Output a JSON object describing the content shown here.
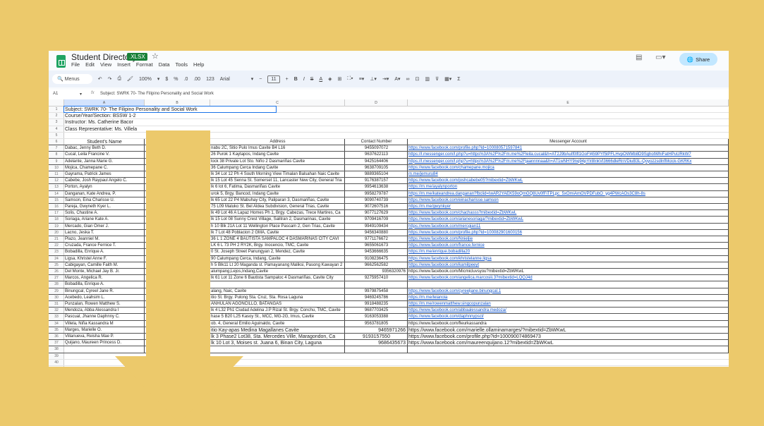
{
  "app": {
    "title": "Student Directory",
    "badge": ".XLSX",
    "menu": [
      "File",
      "Edit",
      "View",
      "Insert",
      "Format",
      "Data",
      "Tools",
      "Help"
    ],
    "share": "Share"
  },
  "toolbar": {
    "search": "Menus",
    "zoom": "100%",
    "currency": "$",
    "percent": "%",
    "dec_down": ".0",
    "dec_up": ".00",
    "format": "123",
    "font": "Arial",
    "font_size": "11",
    "bold": "B",
    "italic": "I",
    "sum": "Σ"
  },
  "formula": {
    "cell_ref": "A1",
    "fx": "fx",
    "content": "Subject: SWRK 70- The Filipino Personality and Social Work"
  },
  "columns": [
    "A",
    "B",
    "C",
    "D",
    "E"
  ],
  "info": [
    "Subject: SWRK 70- The Filipino Personality and Social Work",
    "Course/Year/Section: BSSW 1-2",
    "Instructor: Ms. Catherine Bacor",
    "Class Representative: Ms. Villela"
  ],
  "headers": {
    "name": "Student's Name",
    "address": "Address",
    "contact": "Contact Number",
    "messenger": "Messenger Account"
  },
  "rows": [
    {
      "name": "Dabac, Jenny Beth D.",
      "address": "nabu 2C, Sitio Pulo Imus Cavite B4 L16",
      "contact": "9455097072",
      "messenger": "https://www.facebook.com/profile.php?id=100080571597841"
    },
    {
      "name": "Cucal, Leila Francine V.",
      "address": "26 Purok 1 Kaytapos, Indang Cavite",
      "contact": "9637622113",
      "messenger": "https://l.messenger.com/l.php?u=https%3A%2F%2Fm.me%2Fleila.cucal&h=AT2J9bAuIf0lfl1GoFl459PYf5lPFLHvpOWMb8D9SghotWhiFatHPuURkW7"
    },
    {
      "name": "Adelante, Janna Marie G.",
      "address": "lock 38 Private Lot Sto. Niño 2 Dasmariñas Cavite",
      "contact": "9425164406",
      "messenger": "https://l.messenger.com/l.php?u=https%3A%2F%2Fm.me%2Fjaannnnaa&h=AT1wNHY9nq94pYlr8InkVl3666dleRnVDiuB3L-QoyozzsdlnfMcick-GKRKx"
    },
    {
      "name": "Mojica, Chamepane C.",
      "address": "36 Calumpang Cerca Indang Cavite",
      "contact": "9638709105",
      "messenger": "https://www.facebook.com/chamepane.mojica"
    },
    {
      "name": "Gayrama, Patrick James",
      "address": "lk 34 Lot 12 Ph 4 South Morning View Timalan Balsahan Naic Cavite",
      "contact": "9889365104",
      "messenger": "m.me/jemuru84"
    },
    {
      "name": "Cabebe, Josh Raypaul Angelo C.",
      "address": "lk 15 Lot 45 Senna St. Somerset 11, Lancaster New City, General Tria",
      "contact": "9176387157",
      "messenger": "https://www.facebook.com/joshcabebe05?mibextid=ZbWKwL"
    },
    {
      "name": "Porton, Ayalyn",
      "address": "lk 6 lot 6, Fatima, Dasmariñas Cavite",
      "contact": "9954613638",
      "messenger": "https://m.me/ayalynporton"
    },
    {
      "name": "Danganan, Kate Andrea, P.",
      "address": "urok 5, Brgy. Bancod, Indang Cavite",
      "contact": "9958279787",
      "messenger": "https://m.me/kateandrea.danganan?fbclid=IwAR2YAEK59oQmGQ8Uv0fFiTPLpc_5xOmiAmOVPDFubO_yg4PWcAOs3C8h-8s"
    },
    {
      "name": "Samson, Eina Charisse U.",
      "address": "lk 65 Lot 22 P4 Mabuhay City, Paliparan 3, Dasmariñas, Cavite",
      "contact": "9090740739",
      "messenger": "https://www.facebook.com/einacharisse.samson"
    },
    {
      "name": "Pareja, Gwyneth Kyer L.",
      "address": "75 L09 Maluko St. Bel Aldea Subdivision, General Trias, Cavite",
      "contact": "9072607516",
      "messenger": "https://m.me/gwynkyer"
    },
    {
      "name": "Solis, Chastine A.",
      "address": "lk 49 Lot 46 A Lapaz Homes Ph 1, Brgy. Cabezas, Trece Martires, Ca",
      "contact": "9077127629",
      "messenger": "https://www.facebook.com/chachasss?mibextid=ZbWKwL"
    },
    {
      "name": "Soriaga, Ariane Kate A.",
      "address": "lk 15 Lot 08 Sunny Crest Village, Salitran 2, Dasmarinas, Cavite",
      "contact": "9709416709",
      "messenger": "https://www.facebook.com/arianesoriaga/?mibextid=ZbWKwL"
    },
    {
      "name": "Mercado, Gian Omer J.",
      "address": "h 10 Blk 21A Lot 11 Wellington Place Pascam 2, Gen Trias, Cavite",
      "contact": "9949109434",
      "messenger": "https://www.facebook.com/mercgian11"
    },
    {
      "name": "Lacno, Jeska T.",
      "address": "lk 7 Lot 48 Poblacion 2 GMA, Cavite",
      "contact": "9456340880",
      "messenger": "https://www.facebook.com/profile.php?id=100082901600156"
    },
    {
      "name": "Plazo, Jeanniel M.",
      "address": "36 L 1 ZONE 4 BAUTISTA SAMPALOC 4 DASMARINAS CITY CAVI",
      "contact": "9771176672",
      "messenger": "https://www.facebook.com/Nnieljie"
    },
    {
      "name": "Cruzada, France Fernice T.",
      "address": "LK 6 L 73 PH 2 RY2K, Brgy. Inocencio, TMC, Cavite",
      "contact": "9655061673",
      "messenger": "https://www.facebook.com/france.fernice"
    },
    {
      "name": "Bobadilla, Enrique A.",
      "address": "0 St. Joseph Street Panungyan 2, Mendez, Cavite",
      "contact": "9453666635",
      "messenger": "https://m.me/enrique.bobadilla20"
    },
    {
      "name": "Ligsa, Khristel Anne F.",
      "address": "90 Calumpang Cerca, Indang, Cavite",
      "contact": "9108236475",
      "messenger": "https://www.facebook.com/khristelanne.ligsa"
    },
    {
      "name": "Cabigayan, Camille Faith M.",
      "address": "h 5 Blk11 Lt 20 Maganda st. Pamayanang Maliksi, Pasong Kawayan 2",
      "contact": "9662562582",
      "messenger": "https://www.facebook.com/kamilpeeyt"
    },
    {
      "name": "Del Monte, Michael Jay B. Jr.",
      "address": "alumpang,Lejos,Indang,Cavite",
      "contact": "9356320976",
      "messenger": "https://www.facebook.com/Micmicluvsyou?mibextid=ZbWKwL"
    },
    {
      "name": "Marcos, Angelica R.",
      "address": "lk 61 Lot 11 Zone 6 Bautista Sampaloc 4 Dasmariñas, Cavite City",
      "contact": "9275957410",
      "messenger": "https://www.facebook.com/angelica.marcosiii.3?mibextid=LQQJ4d"
    },
    {
      "name": "Bobadilla, Enrique A.",
      "address": "",
      "contact": "",
      "messenger": ""
    },
    {
      "name": "Binungcal, Cyreel Jane R.",
      "address": "alang, Naic, Cavite",
      "contact": "9979875458",
      "messenger": "https://www.facebook.com/cyreeljane.binungcal.1"
    },
    {
      "name": "Acebedo, Leahsim L.",
      "address": "itio St. Brgy. Pulong Sta. Cruz, Sta. Rosa Laguna",
      "contact": "9469245786",
      "messenger": "https://m.me/leianoia"
    },
    {
      "name": "Punzalan, Rowen Matthew S.",
      "address": "ANHULAN AGONCILLO, BATANGAS",
      "contact": "9918488235",
      "messenger": "https://m.me/rowenmatthew.singcopunzalan"
    },
    {
      "name": "Mendoza, Abba Alessandra I",
      "address": "lk 4 L32 Ph1 Ciudad Adelina J.P Rizal St. Brgy. Conchu, TMC, Cavite",
      "contact": "9687703425",
      "messenger": "https://www.facebook.com/abbaalessandra.medoza/"
    },
    {
      "name": "Pascual, Jhanne Daphnny C.",
      "address": "hase 5 B20 L25 Kasoy St., MCC, MG-2G, Imus, Cavite",
      "contact": "9163053388",
      "messenger": "https://www.facebook.com/daphnnypscl/"
    },
    {
      "name": "Villela, Niña Kassandra M",
      "address": "ob. 4, General Emilio Aguinaldo, Cavite",
      "contact": "9563781805",
      "messenger": "https://www.facebook.com/fleurkassandra"
    },
    {
      "name": "Marges, Marielle O.",
      "address": "itio Kay-apas Medina Magallanes Cavite",
      "contact": "9465971266",
      "messenger": "https://www.facebook.com/marielle.ollaminamarges/?mibextid=ZbWKwL"
    },
    {
      "name": "Villanueva, Reisha Mae P.",
      "address": "lk 3 Phase2 Lot38, Sta. Mercedes Ville, Maragondon, Ca",
      "contact": "9193157550",
      "messenger": "https://www.facebook.com/profile.php?id=100090074869473"
    },
    {
      "name": "Quijano, Maureen Princess D.",
      "address": "lk 10 Lot 3, Moises st. Juana 6, Binan City, Laguna",
      "contact": "9686435673",
      "messenger": "https://www.facebook.com/maureenquijano.12?mibextid=ZbWKwL"
    }
  ],
  "colors": {
    "background": "#ecc96b",
    "link": "#1155cc",
    "share": "#c2e7ff",
    "badge": "#188038"
  }
}
